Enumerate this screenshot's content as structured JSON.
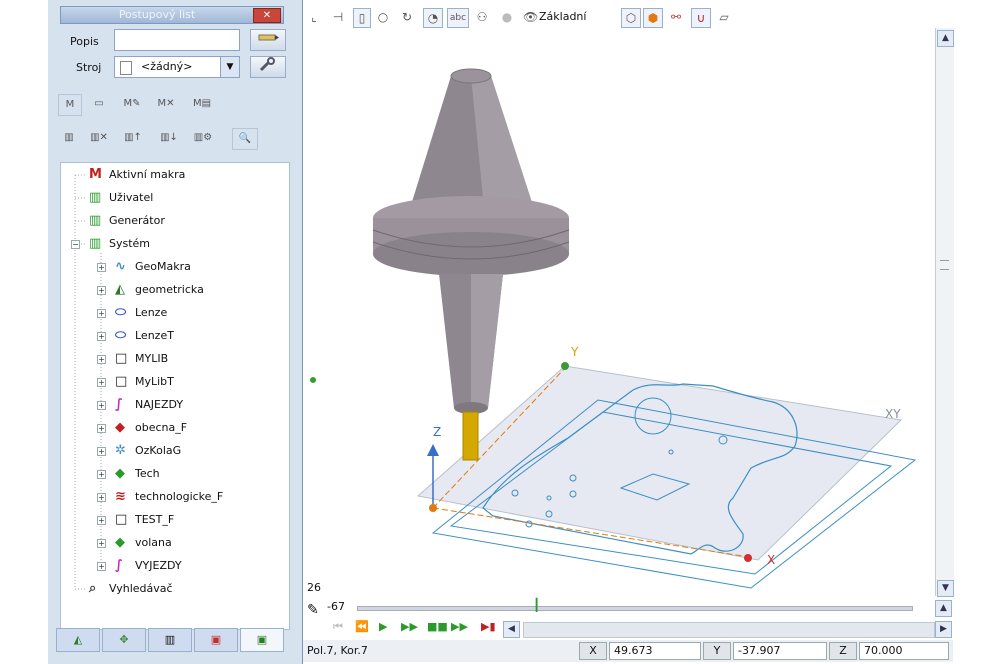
{
  "panel": {
    "title": "Postupový list",
    "close_glyph": "✕",
    "popis_label": "Popis",
    "popis_value": "",
    "stroj_label": "Stroj",
    "stroj_value": "<žádný>"
  },
  "tree": [
    {
      "label": "Aktivní makra",
      "icon": "macro-icon",
      "level": 0
    },
    {
      "label": "Uživatel",
      "icon": "book-icon",
      "level": 0
    },
    {
      "label": "Generátor",
      "icon": "book-icon",
      "level": 0
    },
    {
      "label": "Systém",
      "icon": "book-icon",
      "level": 0,
      "expanded": true
    },
    {
      "label": "GeoMakra",
      "icon": "wave-icon",
      "level": 1
    },
    {
      "label": "geometricka",
      "icon": "geometry-icon",
      "level": 1
    },
    {
      "label": "Lenze",
      "icon": "outline-icon",
      "level": 1
    },
    {
      "label": "LenzeT",
      "icon": "outline-icon",
      "level": 1
    },
    {
      "label": "MYLIB",
      "icon": "square-icon",
      "level": 1
    },
    {
      "label": "MyLibT",
      "icon": "square-icon",
      "level": 1
    },
    {
      "label": "NAJEZDY",
      "icon": "spiral-icon",
      "level": 1
    },
    {
      "label": "obecna_F",
      "icon": "red-book-icon",
      "level": 1
    },
    {
      "label": "OzKolaG",
      "icon": "gear-icon",
      "level": 1
    },
    {
      "label": "Tech",
      "icon": "green-book-icon",
      "level": 1
    },
    {
      "label": "technologicke_F",
      "icon": "layers-icon",
      "level": 1
    },
    {
      "label": "TEST_F",
      "icon": "square-icon",
      "level": 1
    },
    {
      "label": "volana",
      "icon": "green-book-icon",
      "level": 1
    },
    {
      "label": "VYJEZDY",
      "icon": "spiral-icon",
      "level": 1
    },
    {
      "label": "Vyhledávač",
      "icon": "search-icon",
      "level": 0
    }
  ],
  "toolbar": {
    "view_label": "Základní"
  },
  "viewport": {
    "axis_y": "Y",
    "axis_z": "Z",
    "axis_x": "X",
    "plane_label": "XY",
    "side_number": "26",
    "slider_value": "-67"
  },
  "status": {
    "position_text": "Pol.7, Kor.7",
    "x_label": "X",
    "x_value": "49.673",
    "y_label": "Y",
    "y_value": "-37.907",
    "z_label": "Z",
    "z_value": "70.000"
  },
  "colors": {
    "panel_bg": "#d7e2ef",
    "path_blue": "#3c8fc4",
    "tool_yellow": "#d4a800",
    "holder_gray": "#8f8790"
  }
}
